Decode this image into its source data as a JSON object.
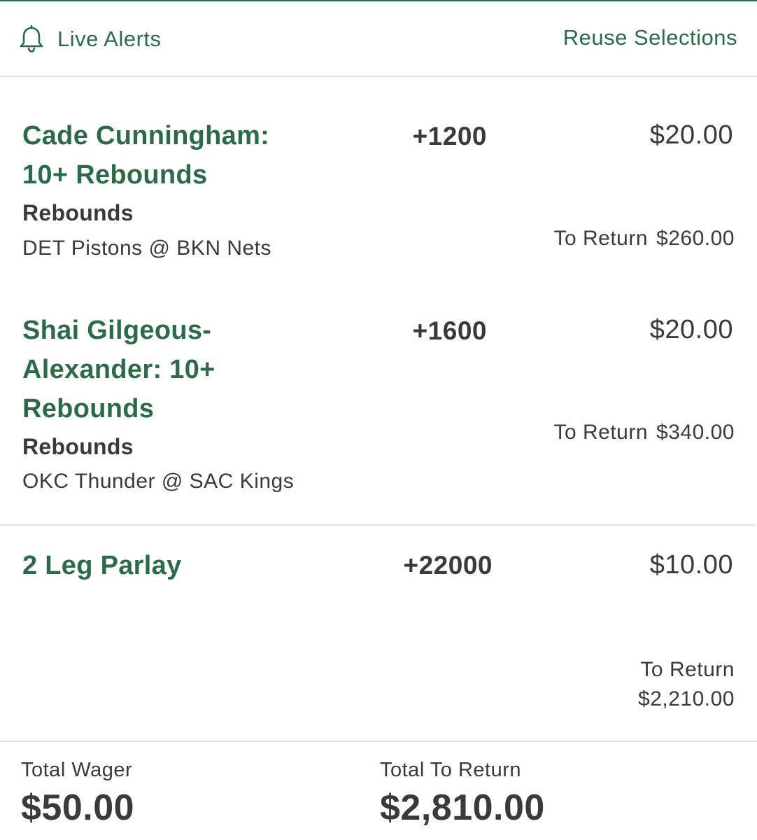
{
  "header": {
    "live_alerts_label": "Live Alerts",
    "reuse_selections_label": "Reuse Selections",
    "bell_icon": "bell-icon"
  },
  "selections": [
    {
      "title_line1": "Cade Cunningham:",
      "title_line2": "10+ Rebounds",
      "odds": "+1200",
      "stake": "$20.00",
      "market": "Rebounds",
      "event": "DET Pistons @ BKN Nets",
      "to_return_label": "To Return",
      "to_return_value": "$260.00"
    },
    {
      "title_line1": "Shai Gilgeous-",
      "title_line2": "Alexander: 10+",
      "title_line3": "Rebounds",
      "odds": "+1600",
      "stake": "$20.00",
      "market": "Rebounds",
      "event": "OKC Thunder @ SAC Kings",
      "to_return_label": "To Return",
      "to_return_value": "$340.00"
    }
  ],
  "parlay": {
    "title": "2 Leg Parlay",
    "odds": "+22000",
    "stake": "$10.00",
    "to_return_label": "To Return",
    "to_return_value": "$2,210.00"
  },
  "totals": {
    "wager_label": "Total Wager",
    "wager_value": "$50.00",
    "return_label": "Total To Return",
    "return_value": "$2,810.00"
  },
  "colors": {
    "accent_green": "#2e6a4a",
    "text_dark": "#3a3a3a",
    "divider": "#e2e2e2"
  }
}
